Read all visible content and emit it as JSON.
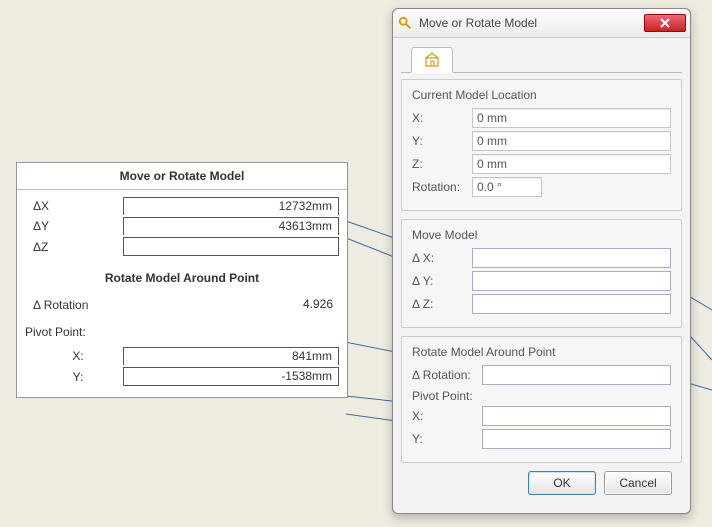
{
  "left_table": {
    "title": "Move or Rotate  Model",
    "dx_label": "ΔX",
    "dy_label": "ΔY",
    "dz_label": "ΔZ",
    "dx_value": "12732mm",
    "dy_value": "43613mm",
    "dz_value": "",
    "rotate_title": "Rotate Model Around Point",
    "drot_label": "Δ  Rotation",
    "drot_value": "4.926",
    "pivot_label": "Pivot Point:",
    "px_label": "X:",
    "py_label": "Y:",
    "px_value": "841mm",
    "py_value": "-1538mm"
  },
  "dialog": {
    "title": "Move or Rotate Model",
    "section_current": "Current Model Location",
    "cx_label": "X:",
    "cy_label": "Y:",
    "cz_label": "Z:",
    "crot_label": "Rotation:",
    "cx_value": "0 mm",
    "cy_value": "0 mm",
    "cz_value": "0 mm",
    "crot_value": "0.0 °",
    "section_move": "Move Model",
    "mdx_label": "Δ X:",
    "mdy_label": "Δ Y:",
    "mdz_label": "Δ Z:",
    "mdx_value": "",
    "mdy_value": "",
    "mdz_value": "",
    "section_rotate": "Rotate Model Around Point",
    "rrot_label": "Δ Rotation:",
    "rrot_value": "",
    "pivot_label": "Pivot Point:",
    "rpx_label": "X:",
    "rpy_label": "Y:",
    "rpx_value": "",
    "rpy_value": "",
    "ok_label": "OK",
    "cancel_label": "Cancel"
  },
  "icons": {
    "app": "magnifier-icon",
    "tab_home": "home-icon",
    "close": "close-icon"
  }
}
